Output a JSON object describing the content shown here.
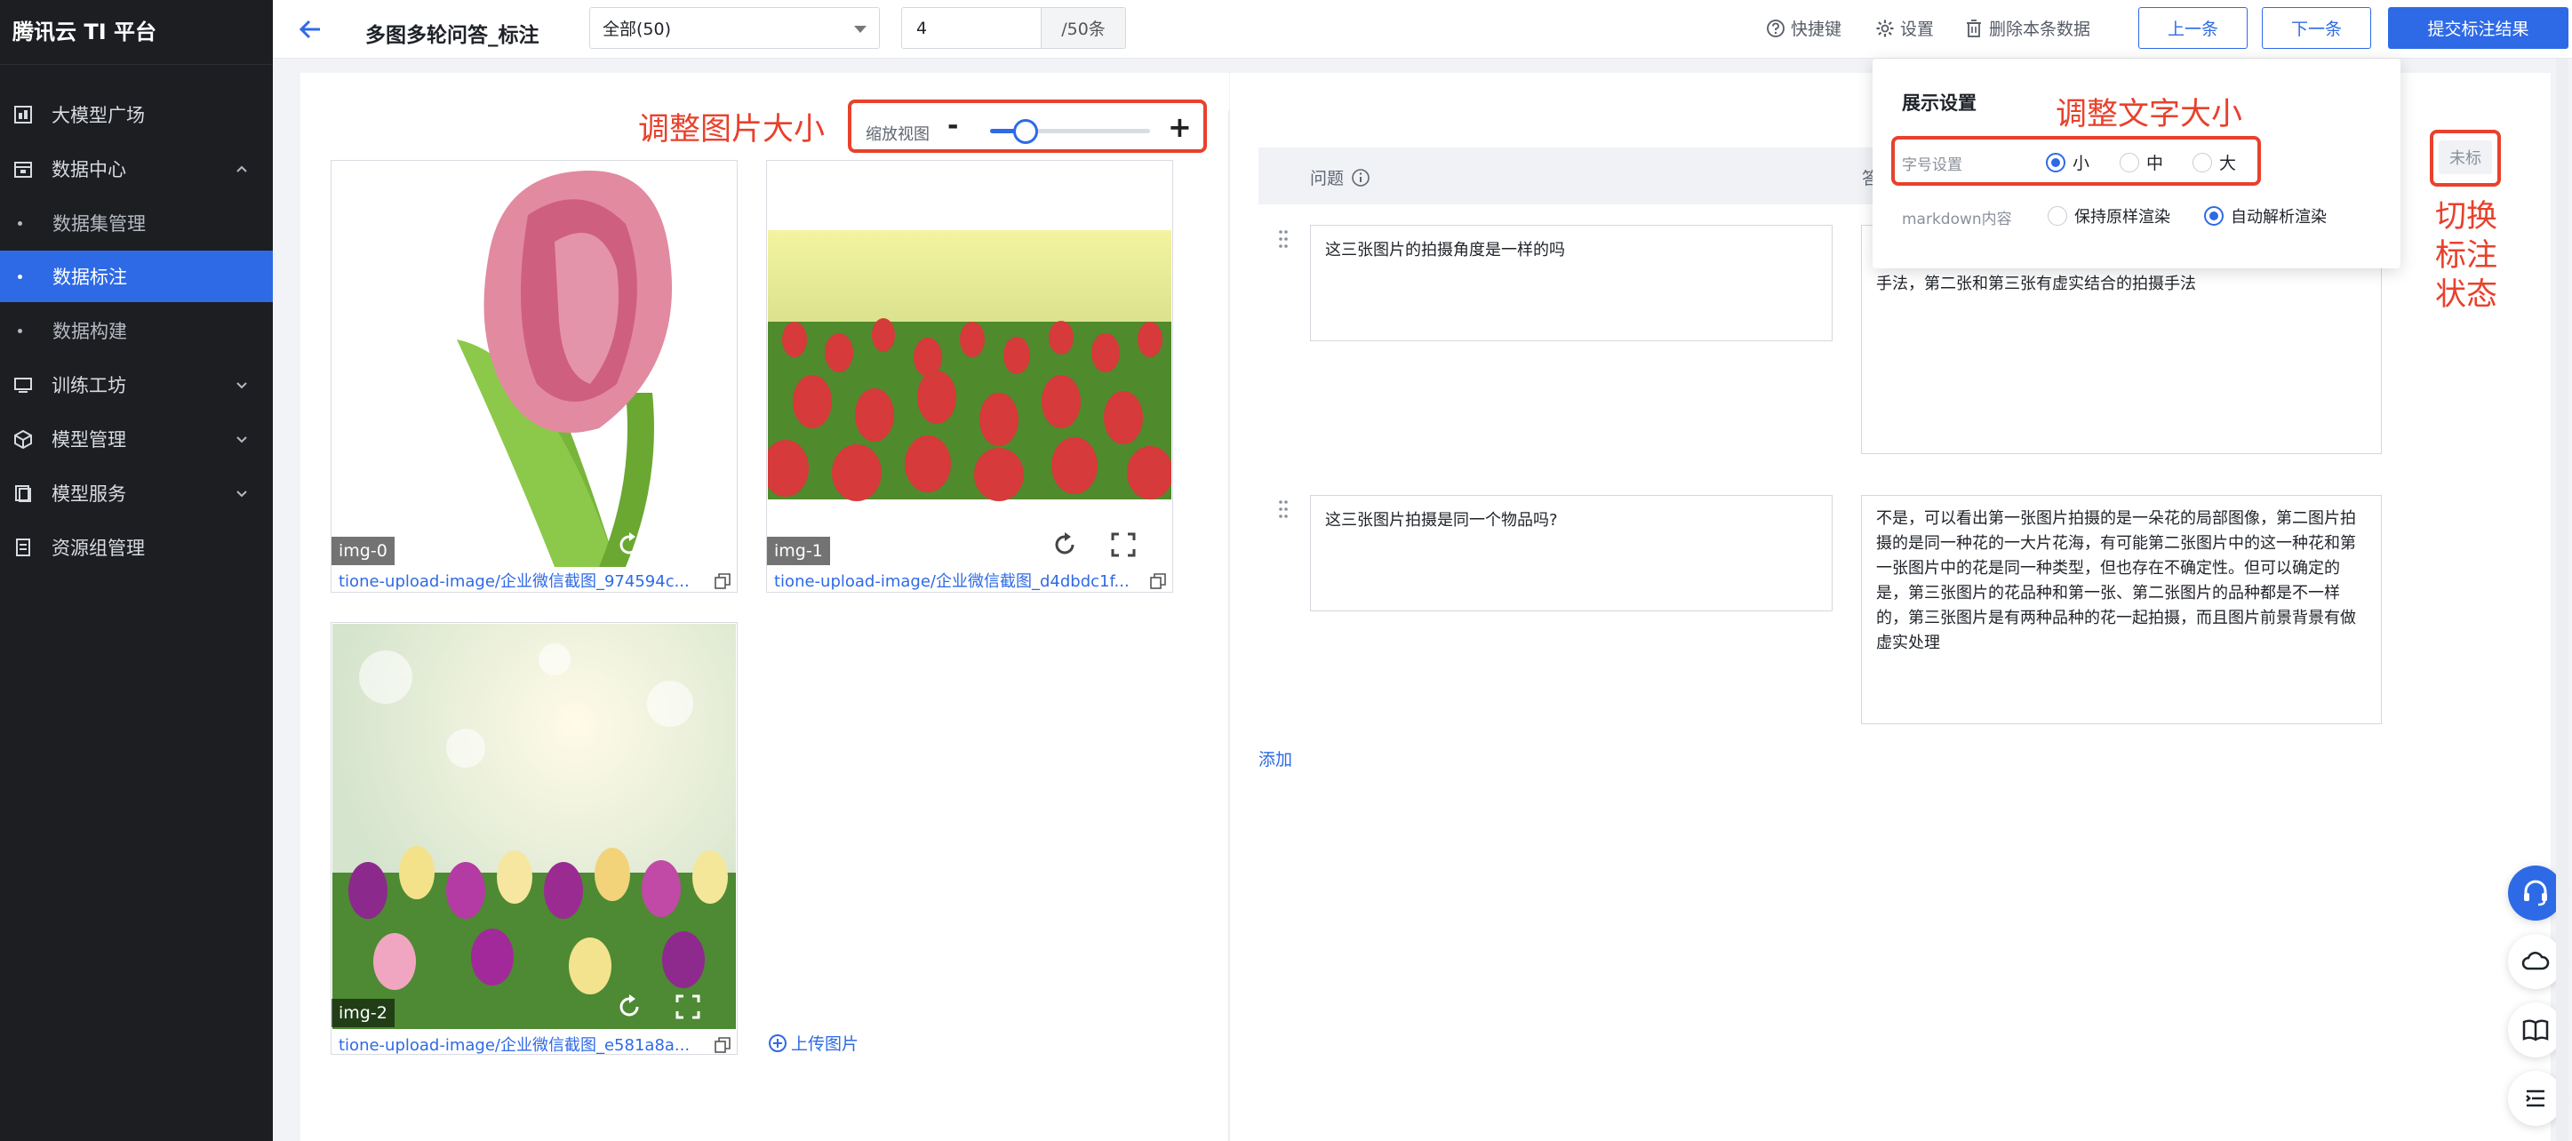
{
  "sidebar": {
    "brand": "腾讯云 TI 平台",
    "items": [
      {
        "label": "大模型广场"
      },
      {
        "label": "数据中心"
      },
      {
        "label": "数据集管理"
      },
      {
        "label": "数据标注"
      },
      {
        "label": "数据构建"
      },
      {
        "label": "训练工坊"
      },
      {
        "label": "模型管理"
      },
      {
        "label": "模型服务"
      },
      {
        "label": "资源组管理"
      }
    ]
  },
  "header": {
    "title": "多图多轮问答_标注",
    "filter_value": "全部(50)",
    "page_value": "4",
    "page_suffix": "/50条",
    "shortcuts_label": "快捷键",
    "settings_label": "设置",
    "delete_label": "删除本条数据",
    "prev_label": "上一条",
    "next_label": "下一条",
    "submit_label": "提交标注结果"
  },
  "annotations": {
    "adjust_image": "调整图片大小",
    "adjust_text": "调整文字大小",
    "toggle_status": "切换\n标注\n状态"
  },
  "zoom": {
    "label": "缩放视图",
    "minus": "-",
    "plus": "+",
    "level": 0.2
  },
  "images": [
    {
      "label": "img-0",
      "link": "tione-upload-image/企业微信截图_974594c..."
    },
    {
      "label": "img-1",
      "link": "tione-upload-image/企业微信截图_d4dbdc1f..."
    },
    {
      "label": "img-2",
      "link": "tione-upload-image/企业微信截图_e581a8a..."
    }
  ],
  "upload_label": "上传图片",
  "table": {
    "question_header": "问题",
    "answer_header": "答",
    "rows": [
      {
        "question": "这三张图片的拍摄角度是一样的吗",
        "answer": "张图片是一片花海的俯视全局的拍摄，而且第一张图片是清晰的拍摄手法，第二张和第三张有虚实结合的拍摄手法"
      },
      {
        "question": "这三张图片拍摄是同一个物品吗?",
        "answer": "不是，可以看出第一张图片拍摄的是一朵花的局部图像，第二图片拍摄的是同一种花的一大片花海，有可能第二张图片中的这一种花和第一张图片中的花是同一种类型，但也存在不确定性。但可以确定的是，第三张图片的花品种和第一张、第二张图片的品种都是不一样的，第三张图片是有两种品种的花一起拍摄，而且图片前景背景有做虚实处理"
      }
    ],
    "add_label": "添加"
  },
  "settings_popover": {
    "title": "展示设置",
    "font_label": "字号设置",
    "font_options": [
      "小",
      "中",
      "大"
    ],
    "font_selected": "小",
    "markdown_label": "markdown内容",
    "markdown_options": [
      "保持原样渲染",
      "自动解析渲染"
    ],
    "markdown_selected": "自动解析渲染"
  },
  "status_chip": "未标",
  "colors": {
    "accent": "#2e6ae6",
    "annotation_red": "#e8412c",
    "sidebar_bg": "#1c1e22"
  }
}
